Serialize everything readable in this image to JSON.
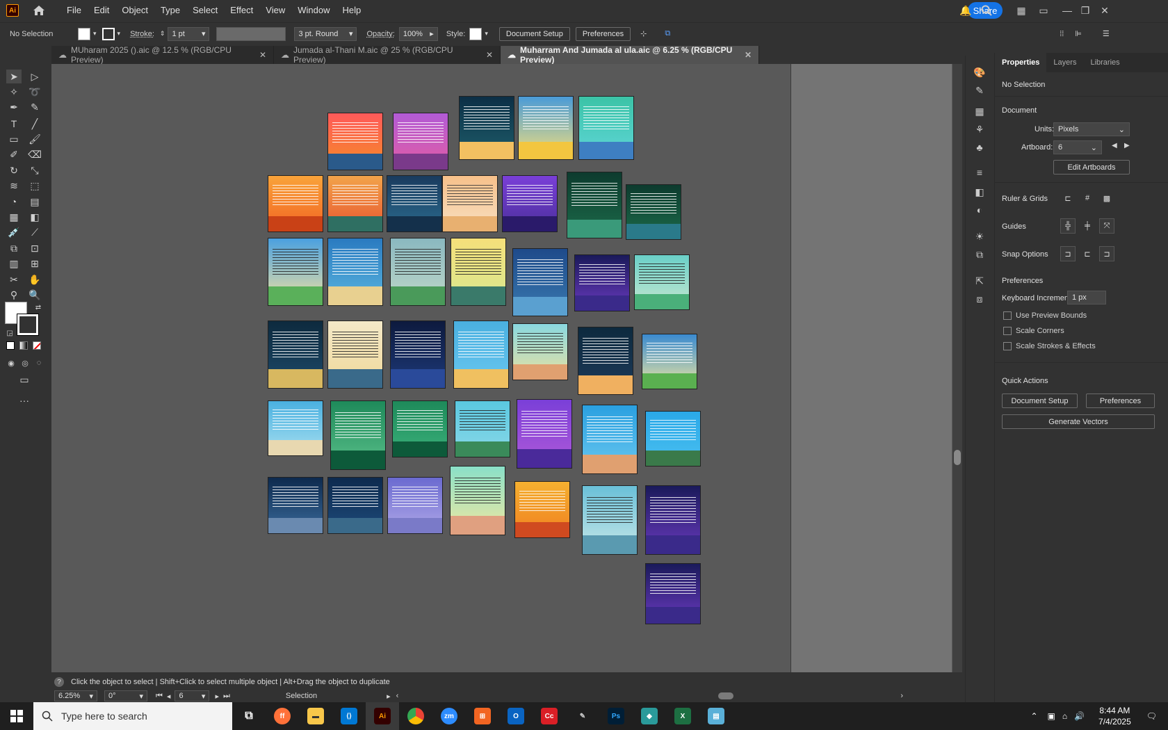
{
  "app": {
    "logo": "Ai"
  },
  "menu": [
    "File",
    "Edit",
    "Object",
    "Type",
    "Select",
    "Effect",
    "View",
    "Window",
    "Help"
  ],
  "top_right": {
    "share_label": "Share"
  },
  "control": {
    "selection": "No Selection",
    "stroke_label": "Stroke:",
    "stroke_value": "1 pt",
    "brush": "3 pt. Round",
    "opacity_label": "Opacity:",
    "opacity_value": "100%",
    "style_label": "Style:",
    "doc_setup": "Document Setup",
    "preferences": "Preferences"
  },
  "tabs": [
    {
      "label": "MUharam 2025 ().aic @ 12.5 % (RGB/CPU Preview)"
    },
    {
      "label": "Jumada al-Thani M.aic @ 25 % (RGB/CPU Preview)"
    },
    {
      "label": "Muharram And Jumada al ula.aic @ 6.25 % (RGB/CPU Preview)"
    }
  ],
  "status": {
    "hint": "Click the object to select  |  Shift+Click to select multiple object  |  Alt+Drag the object to duplicate",
    "zoom": "6.25%",
    "rotate": "0°",
    "artboard": "6",
    "mode": "Selection"
  },
  "panel": {
    "tabs": [
      "Properties",
      "Layers",
      "Libraries"
    ],
    "no_selection": "No Selection",
    "document": "Document",
    "units_label": "Units:",
    "units_value": "Pixels",
    "artboard_label": "Artboard:",
    "artboard_value": "6",
    "edit_artboards": "Edit Artboards",
    "ruler_grids": "Ruler & Grids",
    "guides": "Guides",
    "snap_options": "Snap Options",
    "preferences": "Preferences",
    "keyboard_inc_label": "Keyboard Increment:",
    "keyboard_inc_value": "1 px",
    "use_preview_bounds": "Use Preview Bounds",
    "scale_corners": "Scale Corners",
    "scale_strokes": "Scale Strokes & Effects",
    "quick_actions": "Quick Actions",
    "doc_setup_btn": "Document Setup",
    "preferences_btn": "Preferences",
    "generate_vectors": "Generate Vectors"
  },
  "taskbar": {
    "search_placeholder": "Type here to search",
    "time": "8:44 AM",
    "date": "7/4/2025"
  },
  "colors": {
    "accent": "#1473e6",
    "ai_orange": "#ff9a00"
  }
}
